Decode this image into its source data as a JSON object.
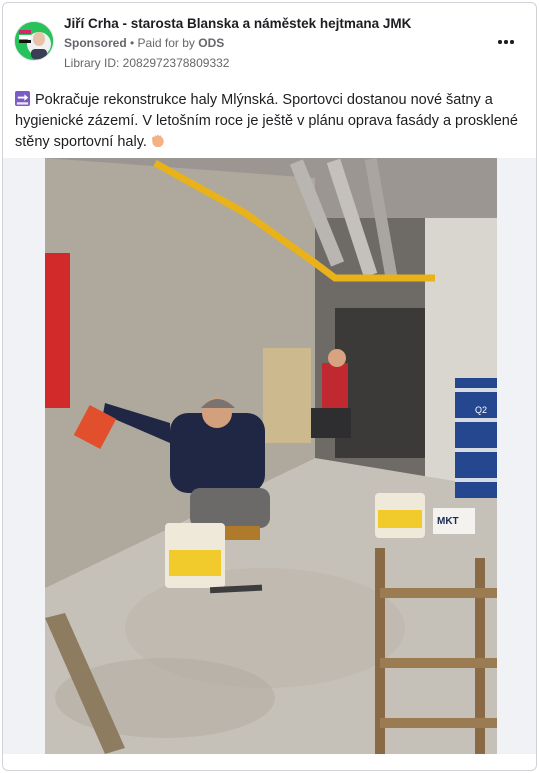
{
  "post": {
    "page_name": "Jiří Crha - starosta Blanska a náměstek hejtmana JMK",
    "sponsored_label": "Sponsored",
    "separator": " • ",
    "paid_for_prefix": "Paid for by ",
    "paid_for_by": "ODS",
    "library_id": "Library ID: 2082972378809332",
    "text": "Pokračuje rekonstrukce haly Mlýnská. Sportovci dostanou nové šatny a hygienické zázemí. V letošním roce je ještě v plánu oprava fasády a prosklené stěny sportovní haly.",
    "icons": [
      "soon-arrow-icon",
      "waving-hand-icon",
      "more-options-icon"
    ],
    "colors": {
      "avatar_bg": "#22c55e",
      "soon_icon": "#7b5cc4",
      "hand": "#f4b183"
    }
  },
  "photo": {
    "bucket_labels": [
      "MKT",
      "Q2"
    ]
  }
}
